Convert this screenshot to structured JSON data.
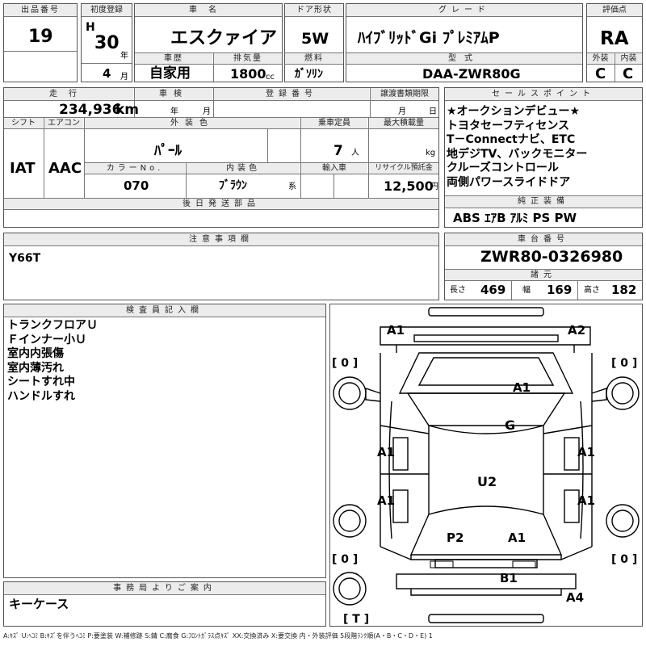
{
  "header": {
    "lot_label": "出品番号",
    "lot": "19",
    "first_reg_label": "初度登録",
    "era": "H",
    "year": "30",
    "year_unit": "年",
    "month": "4",
    "month_unit": "月",
    "name_label": "車名",
    "name": "エスクァイア",
    "history_label": "車歴",
    "history": "自家用",
    "displacement_label": "排気量",
    "displacement": "1800",
    "displacement_unit": "cc",
    "door_label": "ドア形状",
    "door": "5W",
    "fuel_label": "燃料",
    "fuel": "ｶﾞｿﾘﾝ",
    "grade_label": "グレード",
    "grade": "ﾊｲﾌﾞﾘｯﾄﾞGi ﾌﾟﾚﾐｱﾑP",
    "model_label": "型式",
    "model": "DAA-ZWR80G",
    "score_label": "評価点",
    "score": "RA",
    "ext_label": "外装",
    "ext": "C",
    "int_label": "内装",
    "int": "C"
  },
  "info": {
    "mileage_label": "走行",
    "mileage": "234,936",
    "mileage_unit": "km",
    "inspection_label": "車検",
    "ins_year_unit": "年",
    "ins_month_unit": "月",
    "reg_label": "登録番号",
    "transfer_label": "譲渡書類期限",
    "tr_month_unit": "月",
    "tr_day_unit": "日",
    "shift_label": "シフト",
    "shift": "IAT",
    "ac_label": "エアコン",
    "ac": "AAC",
    "color_label": "外装色",
    "color": "ﾊﾟｰﾙ",
    "color_no_label": "カラーNo.",
    "color_no": "070",
    "interior_label": "内装色",
    "interior": "ﾌﾞﾗｳﾝ",
    "interior_unit": "系",
    "capacity_label": "乗車定員",
    "capacity": "7",
    "capacity_unit": "人",
    "load_label": "最大積載量",
    "load_unit": "kg",
    "import_label": "輸入車",
    "recycle_label": "リサイクル預託金",
    "recycle": "12,500",
    "recycle_unit": "円",
    "later_label": "後日発送部品"
  },
  "sales_points": {
    "label": "セールスポイント",
    "items": [
      "★オークションデビュー★",
      "トヨタセーフティセンス",
      "T－Connectナビ、ETC",
      "地デジTV、バックモニター",
      "クルーズコントロール",
      "両側パワースライドドア"
    ]
  },
  "equipment": {
    "label": "純正装備",
    "items": "ABS ｴｱB ｱﾙﾐ PS PW"
  },
  "notes": {
    "label": "注意事項欄",
    "text": "Y66T"
  },
  "chassis": {
    "label": "車台番号",
    "number": "ZWR80-0326980",
    "spec_label": "諸元",
    "len_label": "長さ",
    "len": "469",
    "wid_label": "幅",
    "wid": "169",
    "hgt_label": "高さ",
    "hgt": "182"
  },
  "inspector": {
    "label": "検査員記入欄",
    "items": [
      "トランクフロアＵ",
      "Ｆインナー小Ｕ",
      "室内内張傷",
      "室内薄汚れ",
      "シートすれ中",
      "ハンドルすれ"
    ]
  },
  "office": {
    "label": "事務局よりご案内",
    "text": "キーケース"
  },
  "diagram": {
    "marks": [
      "A1",
      "A2",
      "A1",
      "G",
      "A1",
      "A1",
      "U2",
      "A1",
      "A1",
      "P2",
      "A1",
      "B1",
      "A4"
    ],
    "tire_marks": [
      "[ 0 ]",
      "[ 0 ]",
      "[ 0 ]",
      "[ 0 ]",
      "[ T ]"
    ]
  },
  "legend": "A:ｷｽﾞ U:ﾍｺﾐ B:ｷｽﾞを伴うﾍｺﾐ P:要塗装 W:補修跡 S:錆 C:腐食 G:ﾌﾛﾝﾄｶﾞﾗｽ点ｷｽﾞ XX:交換済み X:要交換 内・外装評価 5段階ﾗﾝｸ順(A・B・C・D・E) 1"
}
